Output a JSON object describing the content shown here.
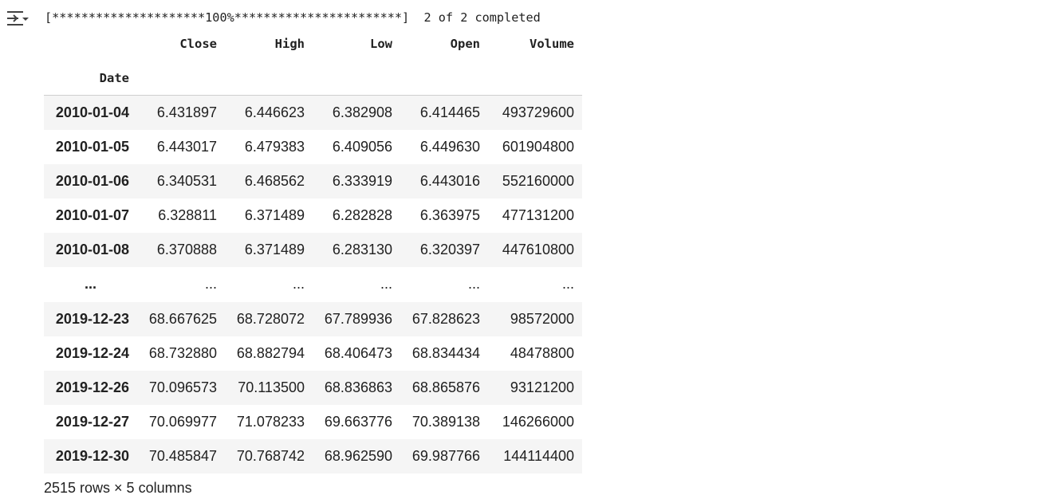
{
  "output": {
    "toggle_icon": "output-collapse-icon",
    "progress_line": "[*********************100%***********************]  2 of 2 completed"
  },
  "dataframe": {
    "columns": [
      "Close",
      "High",
      "Low",
      "Open",
      "Volume"
    ],
    "index_name": "Date",
    "rows": [
      {
        "index": "2010-01-04",
        "values": [
          "6.431897",
          "6.446623",
          "6.382908",
          "6.414465",
          "493729600"
        ]
      },
      {
        "index": "2010-01-05",
        "values": [
          "6.443017",
          "6.479383",
          "6.409056",
          "6.449630",
          "601904800"
        ]
      },
      {
        "index": "2010-01-06",
        "values": [
          "6.340531",
          "6.468562",
          "6.333919",
          "6.443016",
          "552160000"
        ]
      },
      {
        "index": "2010-01-07",
        "values": [
          "6.328811",
          "6.371489",
          "6.282828",
          "6.363975",
          "477131200"
        ]
      },
      {
        "index": "2010-01-08",
        "values": [
          "6.370888",
          "6.371489",
          "6.283130",
          "6.320397",
          "447610800"
        ]
      },
      {
        "index": "...",
        "values": [
          "...",
          "...",
          "...",
          "...",
          "..."
        ]
      },
      {
        "index": "2019-12-23",
        "values": [
          "68.667625",
          "68.728072",
          "67.789936",
          "67.828623",
          "98572000"
        ]
      },
      {
        "index": "2019-12-24",
        "values": [
          "68.732880",
          "68.882794",
          "68.406473",
          "68.834434",
          "48478800"
        ]
      },
      {
        "index": "2019-12-26",
        "values": [
          "70.096573",
          "70.113500",
          "68.836863",
          "68.865876",
          "93121200"
        ]
      },
      {
        "index": "2019-12-27",
        "values": [
          "70.069977",
          "71.078233",
          "69.663776",
          "70.389138",
          "146266000"
        ]
      },
      {
        "index": "2019-12-30",
        "values": [
          "70.485847",
          "70.768742",
          "68.962590",
          "69.987766",
          "144114400"
        ]
      }
    ],
    "dimensions": "2515 rows × 5 columns"
  }
}
